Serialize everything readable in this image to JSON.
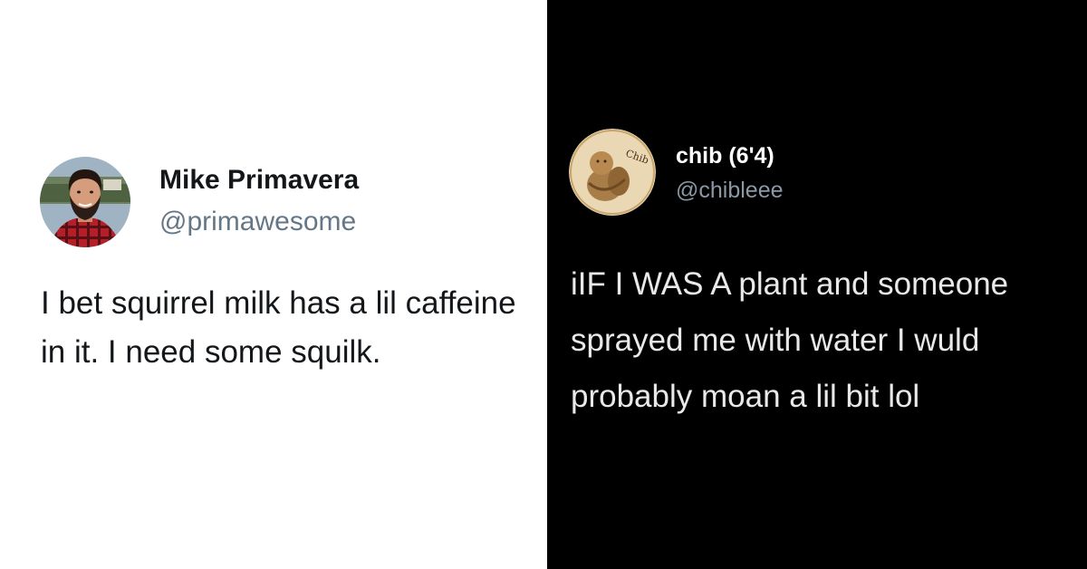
{
  "left_tweet": {
    "display_name": "Mike Primavera",
    "handle": "@primawesome",
    "text": "I bet squirrel milk has a lil caffeine in it. I need some squilk.",
    "theme": "light",
    "background": "#ffffff"
  },
  "right_tweet": {
    "display_name": "chib (6'4)",
    "handle": "@chibleee",
    "text": "iIF I WAS A plant and someone sprayed me with water I wuld probably moan a lil bit lol",
    "avatar_text": "Chib",
    "theme": "dark",
    "background": "#000000"
  }
}
